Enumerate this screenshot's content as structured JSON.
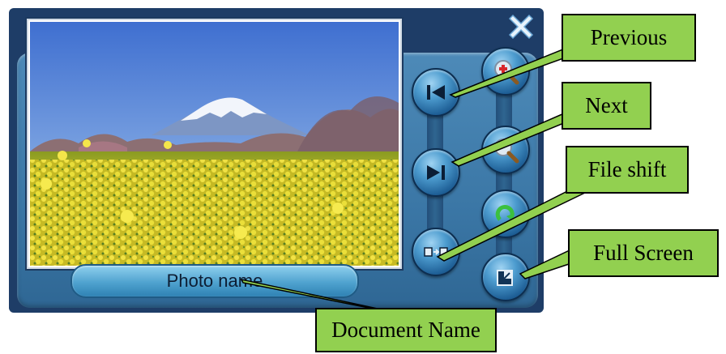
{
  "viewer": {
    "photo_name": "Photo name",
    "buttons": {
      "previous": "previous-icon",
      "next": "next-icon",
      "file_shift": "file-shift-icon",
      "zoom_in": "zoom-in-icon",
      "zoom_out": "zoom-out-icon",
      "rotate": "rotate-icon",
      "full_screen": "full-screen-icon",
      "close": "close-icon"
    }
  },
  "callouts": {
    "previous": "Previous",
    "next": "Next",
    "file_shift": "File shift",
    "full_screen": "Full Screen",
    "document_name": "Document Name"
  },
  "colors": {
    "callout_fill": "#92d050",
    "window_dark": "#1e3d67",
    "panel_blue": "#3b77a6"
  }
}
